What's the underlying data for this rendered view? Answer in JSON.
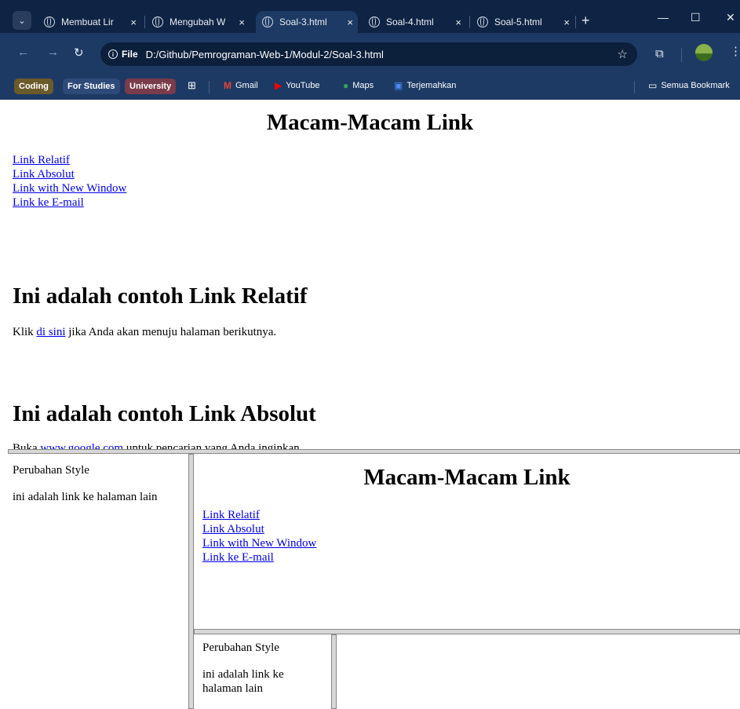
{
  "browser": {
    "tabs": [
      {
        "title": "Membuat Lir",
        "active": false
      },
      {
        "title": "Mengubah W",
        "active": false
      },
      {
        "title": "Soal-3.html",
        "active": true
      },
      {
        "title": "Soal-4.html",
        "active": false
      },
      {
        "title": "Soal-5.html",
        "active": false
      }
    ],
    "tab_close_glyph": "×",
    "new_tab_glyph": "+",
    "window_controls": {
      "minimize": "—",
      "maximize": "☐",
      "close": "✕"
    },
    "omnibox": {
      "scheme_label": "File",
      "url": "D:/Github/Pemrograman-Web-1/Modul-2/Soal-3.html"
    },
    "bookmarks": {
      "groups": [
        {
          "label": "Coding",
          "color": "#6b5a2a"
        },
        {
          "label": "For Studies",
          "color": "#2d4a78"
        },
        {
          "label": "University",
          "color": "#7a3b4a"
        }
      ],
      "items": [
        {
          "label": "Gmail",
          "icon": "gmail-icon"
        },
        {
          "label": "YouTube",
          "icon": "youtube-icon"
        },
        {
          "label": "Maps",
          "icon": "maps-icon"
        },
        {
          "label": "Terjemahkan",
          "icon": "translate-icon"
        }
      ],
      "folder_label": "Semua Bookmark"
    }
  },
  "page": {
    "title": "Macam-Macam Link",
    "links": [
      "Link Relatif",
      "Link Absolut",
      "Link with New Window",
      "Link ke E-mail"
    ],
    "section_relatif": {
      "heading": "Ini adalah contoh Link Relatif",
      "prefix": "Klik ",
      "link": "di sini",
      "suffix": " jika Anda akan menuju halaman berikutnya."
    },
    "section_absolut": {
      "heading": "Ini adalah contoh Link Absolut",
      "prefix": "Buka ",
      "link": "www.google.com",
      "suffix": " untuk pencarian yang Anda inginkan"
    }
  },
  "frames": {
    "left": {
      "title": "Perubahan Style",
      "text": "ini adalah link ke halaman lain"
    },
    "top_right": {
      "title": "Macam-Macam Link",
      "links": [
        "Link Relatif",
        "Link Absolut",
        "Link with New Window",
        "Link ke E-mail"
      ]
    },
    "bottom_left": {
      "title": "Perubahan Style",
      "text_line1": "ini adalah link ke",
      "text_line2": "halaman lain"
    }
  }
}
